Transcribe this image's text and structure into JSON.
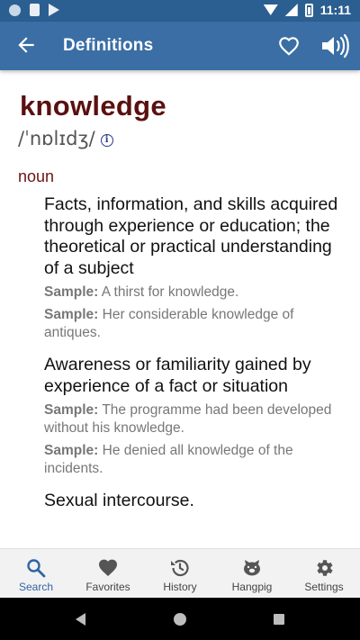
{
  "status_bar": {
    "time": "11:11"
  },
  "app_bar": {
    "title": "Definitions"
  },
  "entry": {
    "word": "knowledge",
    "phonetic": "/ˈnɒlɪdʒ/",
    "part_of_speech": "noun",
    "sample_label": "Sample:",
    "definitions": [
      {
        "text": "Facts, information, and skills acquired through experience or education; the theoretical or practical understanding of a subject",
        "samples": [
          "A thirst for knowledge.",
          "Her considerable knowledge of antiques."
        ]
      },
      {
        "text": "Awareness or familiarity gained by experience of a fact or situation",
        "samples": [
          "The programme had been developed without his knowledge.",
          "He denied all knowledge of the incidents."
        ]
      },
      {
        "text": "Sexual intercourse.",
        "samples": []
      }
    ]
  },
  "bottom_nav": {
    "items": [
      {
        "label": "Search",
        "icon": "search-icon",
        "active": true
      },
      {
        "label": "Favorites",
        "icon": "heart-icon",
        "active": false
      },
      {
        "label": "History",
        "icon": "history-icon",
        "active": false
      },
      {
        "label": "Hangpig",
        "icon": "hangpig-icon",
        "active": false
      },
      {
        "label": "Settings",
        "icon": "gear-icon",
        "active": false
      }
    ]
  },
  "colors": {
    "app_bar": "#3a6ea5",
    "status_bar": "#2c5f91",
    "headword": "#5b1010",
    "nav_active": "#2f66a3"
  }
}
